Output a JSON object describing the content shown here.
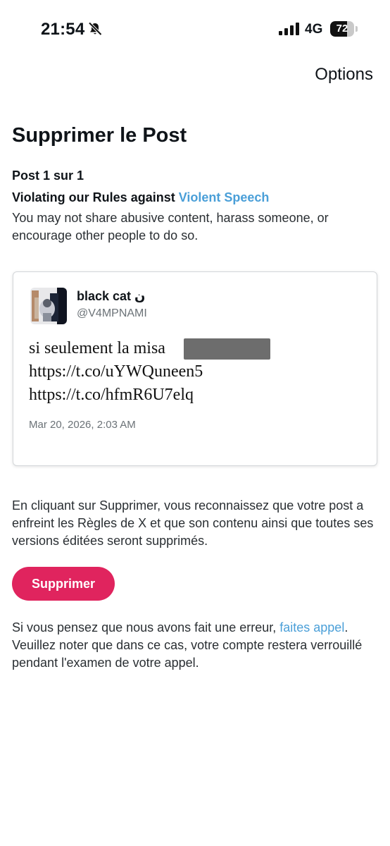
{
  "status_bar": {
    "time": "21:54",
    "network": "4G",
    "battery_level": "72",
    "battery_fraction": 0.72
  },
  "header": {
    "options_label": "Options"
  },
  "main": {
    "title": "Supprimer le Post",
    "post_counter": "Post 1 sur 1",
    "violation_prefix": "Violating our Rules against ",
    "violation_link": "Violent Speech",
    "violation_description": "You may not share abusive content, harass someone, or encourage other people to do so."
  },
  "post": {
    "author_name": "black cat ن",
    "author_handle": "@V4MPNAMI",
    "text_line_1": "si seulement la misa",
    "text_line_2": "https://t.co/uYWQuneen5",
    "text_line_3": "https://t.co/hfmR6U7elq",
    "date": "Mar 20, 2026, 2:03 AM"
  },
  "notice": "En cliquant sur Supprimer, vous reconnaissez que votre post a enfreint les Règles de X et que son contenu ainsi que toutes ses versions éditées seront supprimés.",
  "delete_button_label": "Supprimer",
  "appeal": {
    "prefix": "Si vous pensez que nous avons fait une erreur, ",
    "link": "faites appel",
    "suffix": ". Veuillez noter que dans ce cas, votre compte restera verrouillé pendant l'examen de votre appel."
  },
  "colors": {
    "accent_link": "#4a9fd8",
    "delete_button": "#e0245e"
  }
}
